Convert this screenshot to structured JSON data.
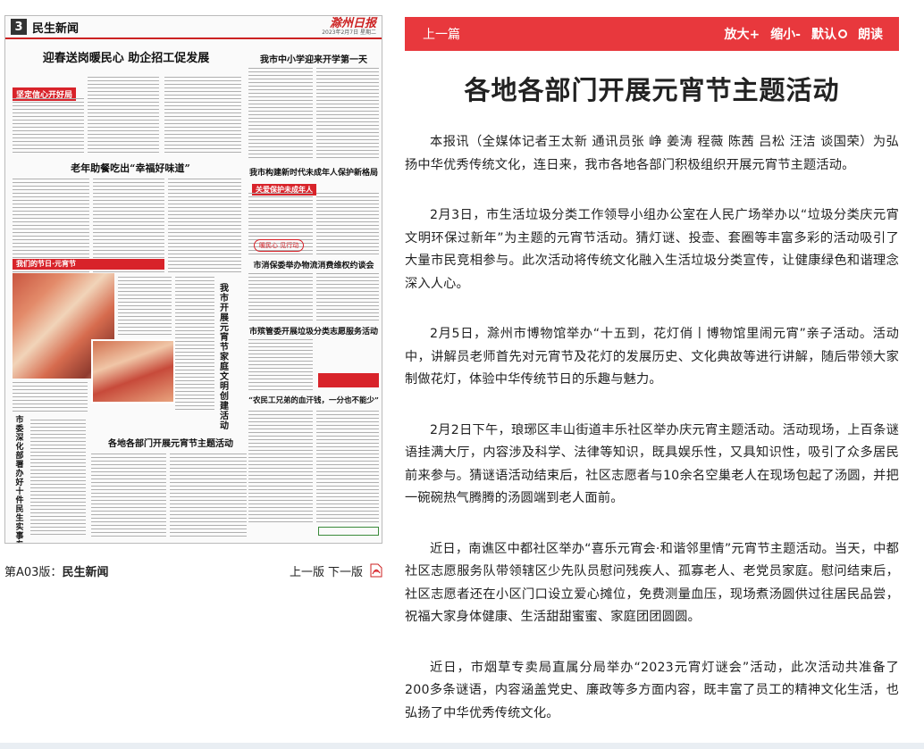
{
  "paper": {
    "page_number": "3",
    "section_name": "民生新闻",
    "brand": "滁州日报",
    "date_line": "2023年2月7日 星期二",
    "headlines": {
      "h1": "迎春送岗暖民心 助企招工促发展",
      "h1_tag": "坚定信心开好局",
      "h2": "老年助餐吃出“幸福好味道”",
      "h3": "我市中小学迎来开学第一天",
      "h4": "我市构建新时代未成年人保护新格局",
      "h4_tag": "关爱保护未成年人",
      "h4_badge": "暖民心 见行动",
      "h5": "市消保委举办物流消费维权约谈会",
      "h6": "市殡管委开展垃圾分类志愿服务活动",
      "h7": "“农民工兄弟的血汗钱，一分也不能少”",
      "h8": "我市开展元宵节家庭文明创建活动",
      "h9": "各地各部门开展元宵节主题活动",
      "h10": "市委深化部署办好十件民生实事专项行动",
      "photo_banner": "我们的节日·元宵节"
    }
  },
  "caption": {
    "edition_prefix": "第A03版：",
    "edition_name": "民生新闻",
    "prev_page": "上一版",
    "next_page": "下一版"
  },
  "toolbar": {
    "prev_article": "上一篇",
    "zoom_in": "放大+",
    "zoom_out": "缩小-",
    "default": "默认",
    "read_aloud": "朗读"
  },
  "article": {
    "title": "各地各部门开展元宵节主题活动",
    "paragraphs": [
      "本报讯（全媒体记者王太新 通讯员张 峥 姜涛 程薇 陈茜 吕松 汪洁 谈国荣）为弘扬中华优秀传统文化，连日来，我市各地各部门积极组织开展元宵节主题活动。",
      "2月3日，市生活垃圾分类工作领导小组办公室在人民广场举办以“垃圾分类庆元宵 文明环保过新年”为主题的元宵节活动。猜灯谜、投壶、套圈等丰富多彩的活动吸引了大量市民竞相参与。此次活动将传统文化融入生活垃圾分类宣传，让健康绿色和谐理念深入人心。",
      "2月5日，滁州市博物馆举办“十五到，花灯俏丨博物馆里闹元宵”亲子活动。活动中，讲解员老师首先对元宵节及花灯的发展历史、文化典故等进行讲解，随后带领大家制做花灯，体验中华传统节日的乐趣与魅力。",
      "2月2日下午，琅琊区丰山街道丰乐社区举办庆元宵主题活动。活动现场，上百条谜语挂满大厅，内容涉及科学、法律等知识，既具娱乐性，又具知识性，吸引了众多居民前来参与。猜谜语活动结束后，社区志愿者与10余名空巢老人在现场包起了汤圆，并把一碗碗热气腾腾的汤圆端到老人面前。",
      "近日，南谯区中都社区举办“喜乐元宵会·和谐邻里情”元宵节主题活动。当天，中都社区志愿服务队带领辖区少先队员慰问残疾人、孤寡老人、老党员家庭。慰问结束后，社区志愿者还在小区门口设立爱心摊位，免费测量血压，现场煮汤圆供过往居民品尝，祝福大家身体健康、生活甜甜蜜蜜、家庭团团圆圆。",
      "近日，市烟草专卖局直属分局举办“2023元宵灯谜会”活动，此次活动共准备了200多条谜语，内容涵盖党史、廉政等多方面内容，既丰富了员工的精神文化生活，也弘扬了中华优秀传统文化。"
    ]
  },
  "colors": {
    "toolbar_bg": "#e8383d",
    "brand_red": "#d8232a"
  }
}
